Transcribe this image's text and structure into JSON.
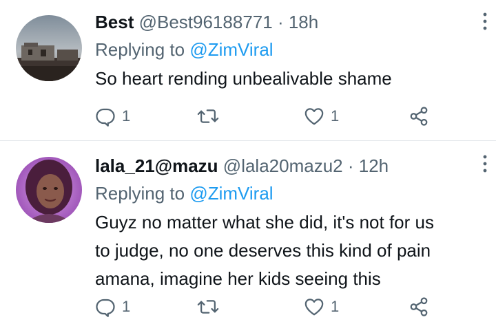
{
  "tweets": [
    {
      "name": "Best",
      "handle": "@Best96188771",
      "separator": "·",
      "time": "18h",
      "replying_prefix": "Replying to ",
      "replying_to": "@ZimViral",
      "text": "So heart rending unbealivable shame",
      "reply_count": "1",
      "retweet_count": "",
      "like_count": "1",
      "avatar_icon": "house-photo"
    },
    {
      "name": "lala_21@mazu",
      "handle": "@lala20mazu2",
      "separator": "·",
      "time": "12h",
      "replying_prefix": "Replying to ",
      "replying_to": "@ZimViral",
      "text_lines": [
        "Guyz no matter what she did, it's not for us",
        "to judge, no one deserves this kind of pain",
        "amana, imagine her kids seeing this"
      ],
      "reply_count": "1",
      "retweet_count": "",
      "like_count": "1",
      "avatar_icon": "portrait-photo"
    }
  ],
  "colors": {
    "text": "#0f1419",
    "secondary": "#536471",
    "accent": "#1d9bf0",
    "divider": "#e1e6ea"
  },
  "icons": [
    "reply-icon",
    "retweet-icon",
    "like-icon",
    "share-icon",
    "more-icon"
  ]
}
